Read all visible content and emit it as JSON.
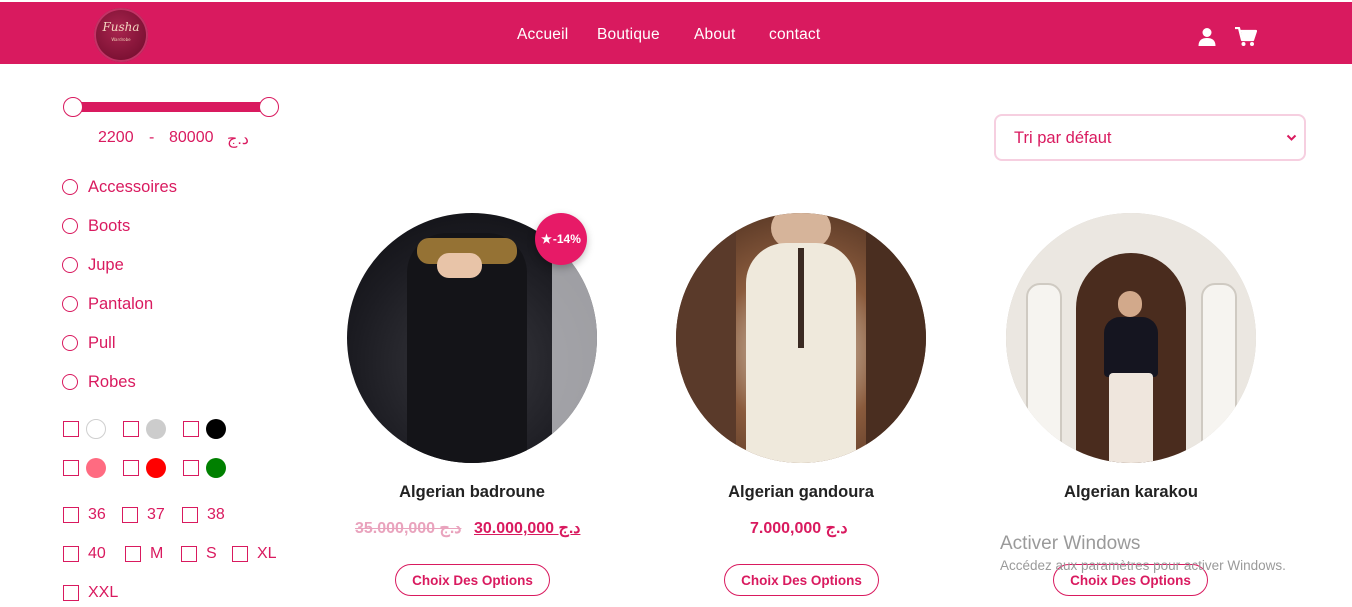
{
  "brand": {
    "logo_text": "Fusha",
    "logo_subtitle": "Wardrobe",
    "colors": {
      "primary": "#d91a5f",
      "badge": "#e71a67",
      "old_price": "#e9a3bd",
      "text": "#222222"
    }
  },
  "header": {
    "nav": [
      {
        "label": "Accueil"
      },
      {
        "label": "Boutique"
      },
      {
        "label": "About"
      },
      {
        "label": "contact"
      }
    ],
    "icons": [
      "user-icon",
      "cart-icon"
    ]
  },
  "filters": {
    "price": {
      "min": "2200",
      "separator": "-",
      "max": "80000",
      "currency": "د.ج"
    },
    "categories": [
      {
        "label": "Accessoires"
      },
      {
        "label": "Boots"
      },
      {
        "label": "Jupe"
      },
      {
        "label": "Pantalon"
      },
      {
        "label": "Pull"
      },
      {
        "label": "Robes"
      }
    ],
    "colors": [
      "#ffffff",
      "#cccccc",
      "#000000",
      "#ff6b81",
      "#ff0000",
      "#008000"
    ],
    "sizes": [
      {
        "label": "36"
      },
      {
        "label": "37"
      },
      {
        "label": "38"
      },
      {
        "label": "40"
      },
      {
        "label": "M"
      },
      {
        "label": "S"
      },
      {
        "label": "XL"
      },
      {
        "label": "XXL"
      }
    ]
  },
  "sort": {
    "selected": "Tri par défaut"
  },
  "products": [
    {
      "name": "Algerian badroune",
      "old_price": "35.000,000 د.ج",
      "price": "30.000,000 د.ج",
      "badge": "-14%",
      "button": "Choix Des Options"
    },
    {
      "name": "Algerian gandoura",
      "price": "7.000,000 د.ج",
      "button": "Choix Des Options"
    },
    {
      "name": "Algerian karakou",
      "button": "Choix Des Options"
    }
  ],
  "watermark": {
    "title": "Activer Windows",
    "subtitle": "Accédez aux paramètres pour activer Windows."
  }
}
